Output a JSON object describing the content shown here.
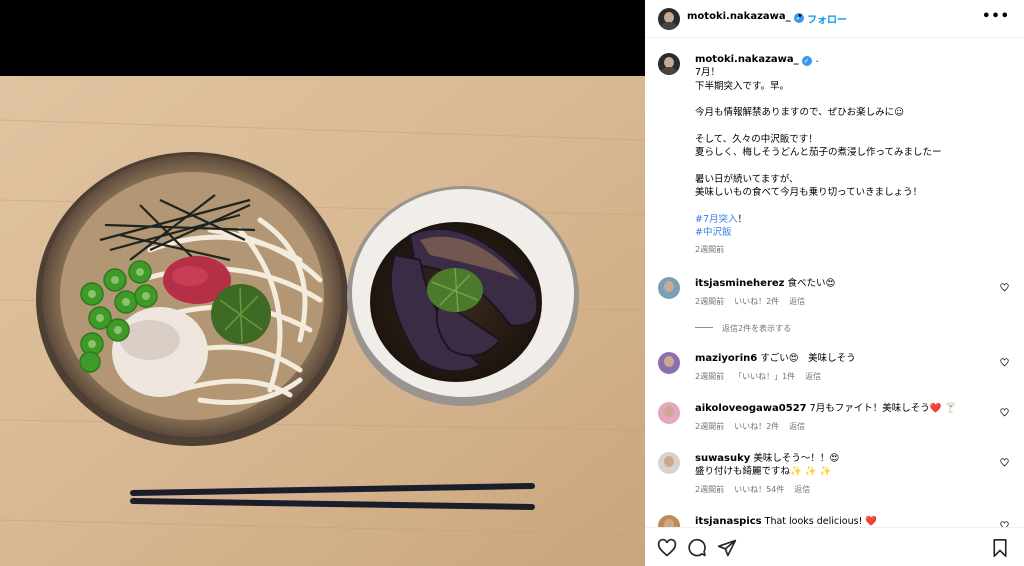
{
  "post": {
    "username": "motoki.nakazawa_",
    "follow_label": "フォロー",
    "separator": "•"
  },
  "caption": {
    "username": "motoki.nakazawa_",
    "username_suffix": ".",
    "lines": [
      "7月！",
      "下半期突入です。早。",
      "",
      "今月も情報解禁ありますので、ぜひお楽しみに☺",
      "",
      "そして、久々の中沢飯です！",
      "夏らしく、梅しそうどんと茄子の煮浸し作ってみましたー",
      "",
      "暑い日が続いてますが、",
      "美味しいもの食べて今月も乗り切っていきましょう！",
      ""
    ],
    "hashtags": [
      "#7月突入",
      "#中沢飯"
    ],
    "hashtag_suffix": "！",
    "time": "2週間前"
  },
  "comments": [
    {
      "username": "itsjasmineherez",
      "text": "食べたい😍",
      "time": "2週間前",
      "likes": "いいね！2件",
      "reply": "返信"
    },
    {
      "username": "maziyorin6",
      "text": "すごい😍　美味しそう",
      "time": "2週間前",
      "likes": "「いいね！」1件",
      "reply": "返信"
    },
    {
      "username": "aikoloveogawa0527",
      "text": "7月もファイト！美味しそう❤️ 🍸",
      "time": "2週間前",
      "likes": "いいね！2件",
      "reply": "返信"
    },
    {
      "username": "suwasuky",
      "text": "美味しそう〜！！😍",
      "text2": "盛り付けも綺麗ですね✨ ✨ ✨",
      "time": "2週間前",
      "likes": "いいね！54件",
      "reply": "返信"
    },
    {
      "username": "itsjanaspics",
      "text": "That looks delicious! ❤️"
    }
  ],
  "view_replies": "返信2件を表示する",
  "icons": {
    "more": "more-options-icon",
    "verified": "verified-badge-icon",
    "like": "heart-icon",
    "comment": "comment-icon",
    "share": "share-icon",
    "save": "bookmark-icon"
  },
  "colors": {
    "accent": "#0095f6",
    "verified": "#3897f0",
    "hashtag": "#3b7fe0",
    "muted": "#737373"
  }
}
